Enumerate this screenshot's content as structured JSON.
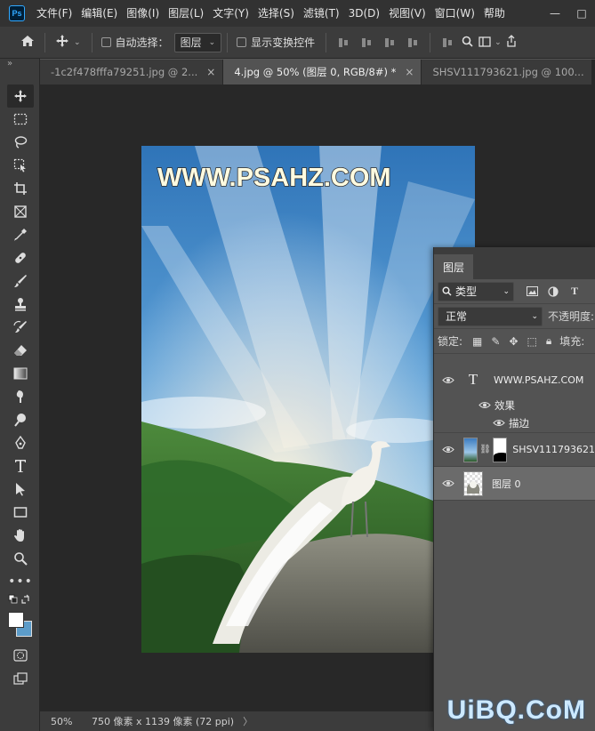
{
  "menubar": {
    "logo": "Ps",
    "items": [
      "文件(F)",
      "编辑(E)",
      "图像(I)",
      "图层(L)",
      "文字(Y)",
      "选择(S)",
      "滤镜(T)",
      "3D(D)",
      "视图(V)",
      "窗口(W)",
      "帮助"
    ],
    "window_controls": [
      "—",
      "□"
    ]
  },
  "options": {
    "auto_select_label": "自动选择：",
    "auto_select_target": "图层",
    "show_transform_label": "显示变换控件"
  },
  "tabs": [
    {
      "label": "-1c2f478fffa79251.jpg @ 2...",
      "active": false
    },
    {
      "label": "4.jpg @ 50% (图层 0, RGB/8#) *",
      "active": true
    },
    {
      "label": "SHSV111793621.jpg @ 100...",
      "active": false
    }
  ],
  "tab_close": "×",
  "canvas": {
    "watermark_text": "WWW.PSAHZ.COM"
  },
  "status": {
    "zoom": "50%",
    "doc_info": "750 像素 x 1139 像素 (72 ppi)",
    "arrow": "〉"
  },
  "layers_panel": {
    "tab_label": "图层",
    "filter_kind": "类型",
    "blend_mode": "正常",
    "opacity_label": "不透明度:",
    "lock_label": "锁定:",
    "fill_label": "填充:",
    "layers": [
      {
        "name": "WWW.PSAHZ.COM",
        "kind": "text",
        "selected": false
      },
      {
        "name": "SHSV111793621",
        "kind": "masked",
        "selected": false
      },
      {
        "name": "图层 0",
        "kind": "image",
        "selected": true
      }
    ],
    "effects_label": "效果",
    "stroke_label": "描边"
  },
  "site_watermark": "UiBQ.CoM",
  "colors": {
    "menubar_bg": "#323232",
    "panel_bg": "#535353",
    "canvas_bg": "#282828",
    "ps_accent": "#31a8ff"
  }
}
